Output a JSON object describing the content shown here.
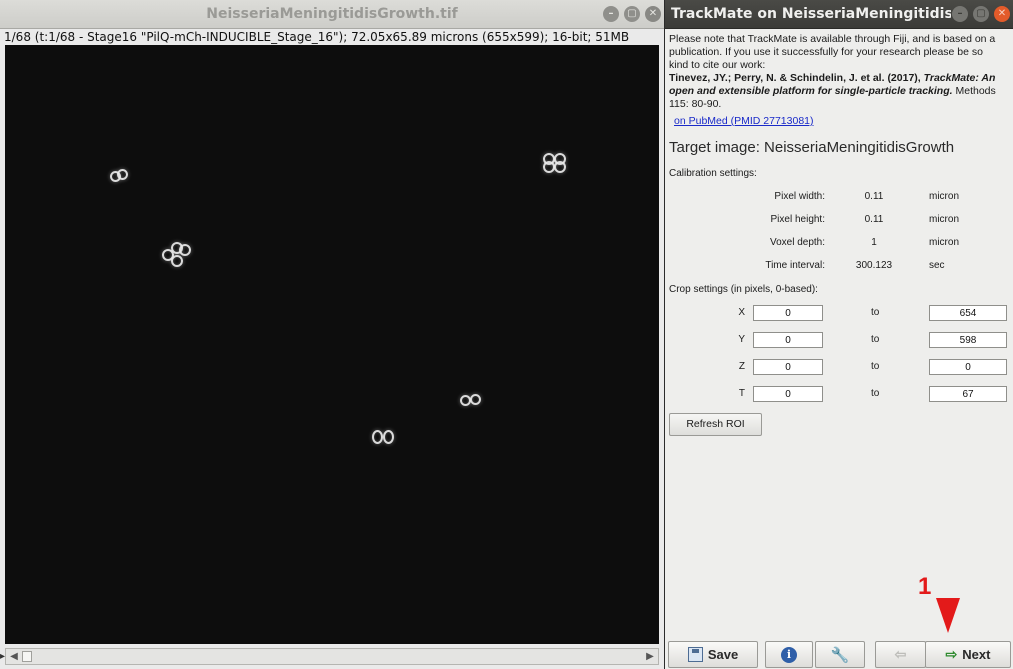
{
  "image_window": {
    "title": "NeisseriaMeningitidisGrowth.tif",
    "info": "1/68 (t:1/68 - Stage16 \"PilQ-mCh-INDUCIBLE_Stage_16\"); 72.05x65.89 microns (655x599); 16-bit; 51MB",
    "scroll_left": "◀",
    "scroll_right": "▶"
  },
  "trackmate": {
    "title": "TrackMate on NeisseriaMeningitidisG...",
    "note": "Please note that TrackMate is available through Fiji, and is based on a publication. If you use it successfully for your research please be so kind to cite our work:",
    "citation_authors": "Tinevez, JY.; Perry, N. & Schindelin, J. et al. (2017),",
    "citation_title": "TrackMate: An open and extensible platform for single-particle tracking.",
    "citation_journal": "Methods 115: 80-90.",
    "pubmed_link": "on PubMed (PMID 27713081)",
    "target_image": "Target image: NeisseriaMeningitidisGrowth",
    "calibration_header": "Calibration settings:",
    "calibration": [
      {
        "label": "Pixel width:",
        "value": "0.11",
        "unit": "micron"
      },
      {
        "label": "Pixel height:",
        "value": "0.11",
        "unit": "micron"
      },
      {
        "label": "Voxel depth:",
        "value": "1",
        "unit": "micron"
      },
      {
        "label": "Time interval:",
        "value": "300.123",
        "unit": "sec"
      }
    ],
    "crop_header": "Crop settings (in pixels, 0-based):",
    "to_label": "to",
    "crop": [
      {
        "axis": "X",
        "from": "0",
        "to": "654"
      },
      {
        "axis": "Y",
        "from": "0",
        "to": "598"
      },
      {
        "axis": "Z",
        "from": "0",
        "to": "0"
      },
      {
        "axis": "T",
        "from": "0",
        "to": "67"
      }
    ],
    "refresh_label": "Refresh ROI",
    "buttons": {
      "save": "Save",
      "next": "Next"
    }
  },
  "annotation": {
    "step_number": "1",
    "color": "#e31a1a"
  },
  "window_buttons": {
    "minimize": "–",
    "maximize": "▢",
    "close": "✕"
  }
}
